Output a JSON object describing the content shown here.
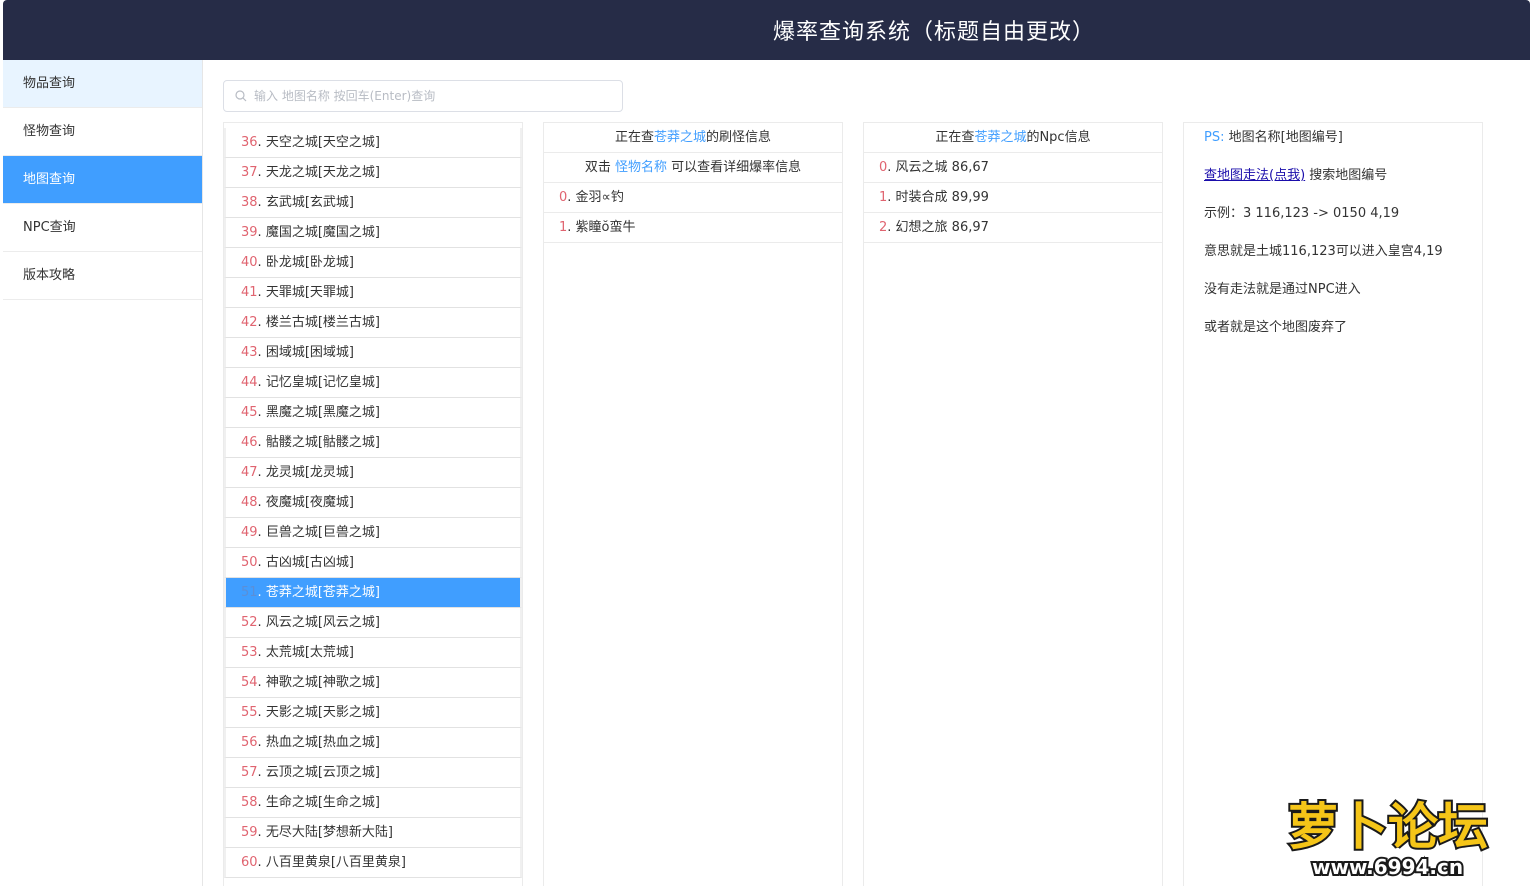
{
  "header": {
    "title": "爆率查询系统（标题自由更改）"
  },
  "sidebar": {
    "items": [
      {
        "label": "物品查询"
      },
      {
        "label": "怪物查询"
      },
      {
        "label": "地图查询"
      },
      {
        "label": "NPC查询"
      },
      {
        "label": "版本攻略"
      }
    ]
  },
  "search": {
    "placeholder": "输入 地图名称 按回车(Enter)查询",
    "value": ""
  },
  "maps": [
    {
      "num": "36",
      "name": "天空之城[天空之城]"
    },
    {
      "num": "37",
      "name": "天龙之城[天龙之城]"
    },
    {
      "num": "38",
      "name": "玄武城[玄武城]"
    },
    {
      "num": "39",
      "name": "魔国之城[魔国之城]"
    },
    {
      "num": "40",
      "name": "卧龙城[卧龙城]"
    },
    {
      "num": "41",
      "name": "天罪城[天罪城]"
    },
    {
      "num": "42",
      "name": "楼兰古城[楼兰古城]"
    },
    {
      "num": "43",
      "name": "困域城[困域城]"
    },
    {
      "num": "44",
      "name": "记忆皇城[记忆皇城]"
    },
    {
      "num": "45",
      "name": "黑魔之城[黑魔之城]"
    },
    {
      "num": "46",
      "name": "骷髅之城[骷髅之城]"
    },
    {
      "num": "47",
      "name": "龙灵城[龙灵城]"
    },
    {
      "num": "48",
      "name": "夜魔城[夜魔城]"
    },
    {
      "num": "49",
      "name": "巨兽之城[巨兽之城]"
    },
    {
      "num": "50",
      "name": "古凶城[古凶城]"
    },
    {
      "num": "51",
      "name": "苍莽之城[苍莽之城]"
    },
    {
      "num": "52",
      "name": "风云之城[风云之城]"
    },
    {
      "num": "53",
      "name": "太荒城[太荒城]"
    },
    {
      "num": "54",
      "name": "神歌之城[神歌之城]"
    },
    {
      "num": "55",
      "name": "天影之城[天影之城]"
    },
    {
      "num": "56",
      "name": "热血之城[热血之城]"
    },
    {
      "num": "57",
      "name": "云顶之城[云顶之城]"
    },
    {
      "num": "58",
      "name": "生命之城[生命之城]"
    },
    {
      "num": "59",
      "name": "无尽大陆[梦想新大陆]"
    },
    {
      "num": "60",
      "name": "八百里黄泉[八百里黄泉]"
    }
  ],
  "selected_map": "苍莽之城",
  "monster_panel": {
    "head_prefix": "正在查",
    "head_suffix": "的刷怪信息",
    "hint_prefix": "双击",
    "hint_link": "怪物名称",
    "hint_suffix": "可以查看详细爆率信息",
    "rows": [
      {
        "num": "0",
        "name": "金羽∝钓"
      },
      {
        "num": "1",
        "name": "紫瞳ŏ蛮牛"
      }
    ]
  },
  "npc_panel": {
    "head_prefix": "正在查",
    "head_suffix": "的Npc信息",
    "rows": [
      {
        "num": "0",
        "name": "风云之城 86,67"
      },
      {
        "num": "1",
        "name": "时装合成 89,99"
      },
      {
        "num": "2",
        "name": "幻想之旅 86,97"
      }
    ]
  },
  "info_panel": {
    "ps_label": "PS:",
    "ps_text": "地图名称[地图编号]",
    "link_text": "查地图走法(点我)",
    "link_suffix": "搜索地图编号",
    "example": "示例：3 116,123 -> 0150 4,19",
    "meaning": "意思就是土城116,123可以进入皇宫4,19",
    "no_path": "没有走法就是通过NPC进入",
    "abandoned": "或者就是这个地图废弃了"
  },
  "watermark": {
    "text": "萝卜论坛",
    "url": "www.6994.cn"
  },
  "colors": {
    "header_bg": "#262c47",
    "accent": "#409eff",
    "number": "#e06470"
  }
}
